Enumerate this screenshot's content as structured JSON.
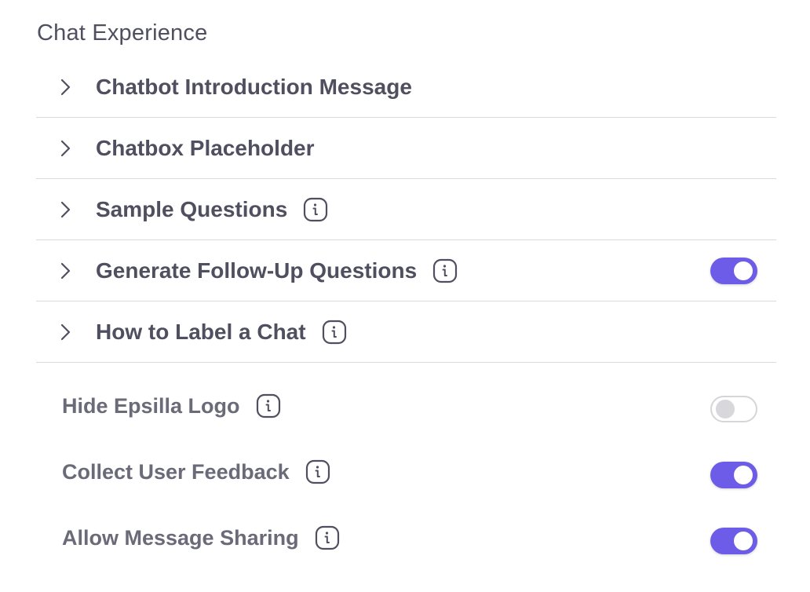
{
  "section": {
    "title": "Chat Experience"
  },
  "accordion": [
    {
      "label": "Chatbot Introduction Message",
      "info": false,
      "toggle": null
    },
    {
      "label": "Chatbox Placeholder",
      "info": false,
      "toggle": null
    },
    {
      "label": "Sample Questions",
      "info": true,
      "toggle": null
    },
    {
      "label": "Generate Follow-Up Questions",
      "info": true,
      "toggle": true
    },
    {
      "label": "How to Label a Chat",
      "info": true,
      "toggle": null
    }
  ],
  "settings": [
    {
      "label": "Hide Epsilla Logo",
      "info": true,
      "toggle": false
    },
    {
      "label": "Collect User Feedback",
      "info": true,
      "toggle": true
    },
    {
      "label": "Allow Message Sharing",
      "info": true,
      "toggle": true
    }
  ],
  "icons": {
    "expand": "chevron-right-icon",
    "info": "info-icon"
  },
  "colors": {
    "accent": "#6c5ce7",
    "text": "#4f4f5f",
    "muted_text": "#6a6a78",
    "divider": "#d9d9de",
    "toggle_off_border": "#d5d5da",
    "toggle_off_knob": "#d7d7dc"
  }
}
